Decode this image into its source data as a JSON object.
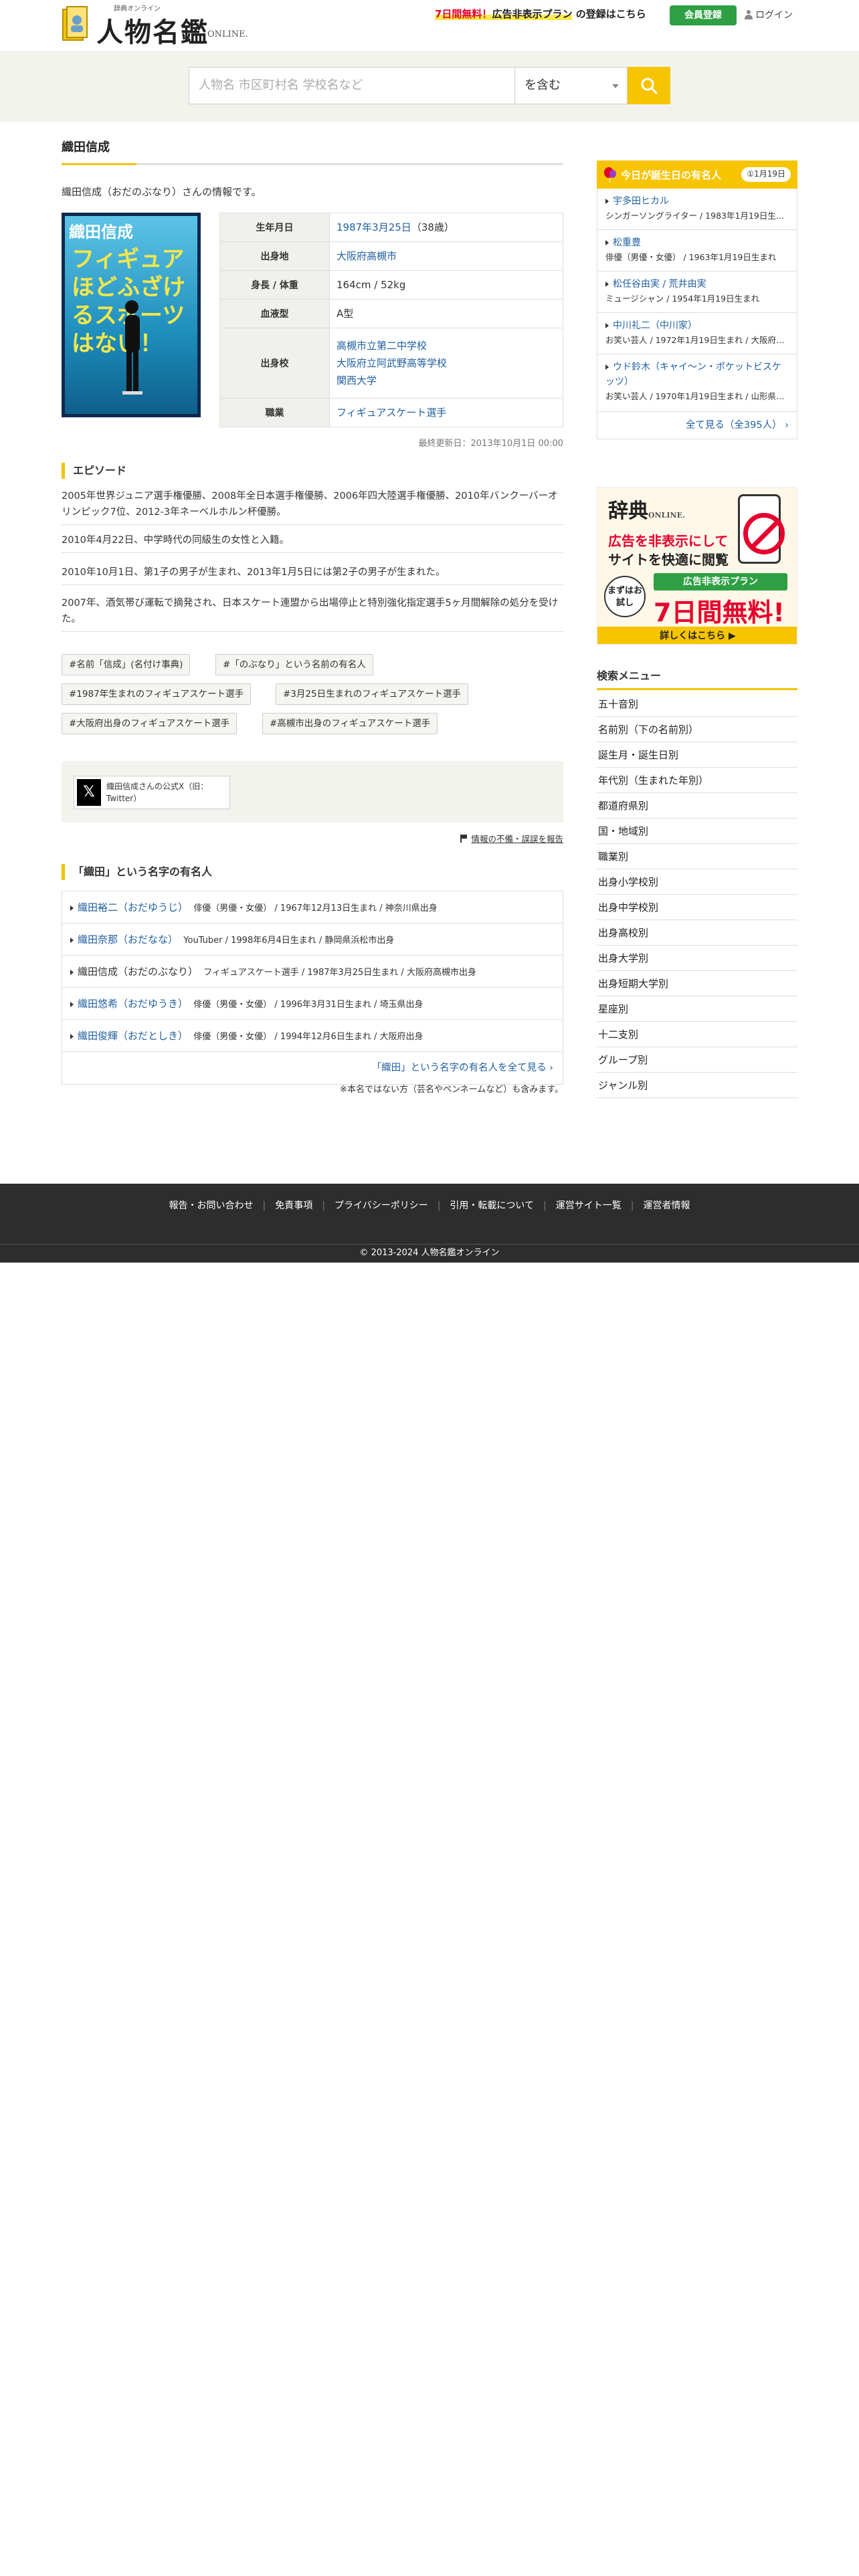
{
  "header": {
    "logo_small": "辞典オンライン",
    "logo_main": "人物名鑑",
    "logo_online": "ONLINE.",
    "promo_red": "7日間無料！",
    "promo_hl": "広告非表示プラン",
    "promo_rest": "の登録はこちら",
    "register_label": "会員登録",
    "login_label": "ログイン"
  },
  "search": {
    "placeholder": "人物名 市区町村名 学校名など",
    "mode": "を含む"
  },
  "main": {
    "title": "織田信成",
    "intro": "織田信成（おだのぶなり）さんの情報です。",
    "cover": {
      "name": "織田信成",
      "text": "フィギュアほどふざけるスポーツはない！"
    },
    "info": {
      "birth_label": "生年月日",
      "birth_value": "1987年3月25日",
      "birth_age": "（38歳）",
      "from_label": "出身地",
      "from_value": "大阪府高槻市",
      "body_label": "身長 / 体重",
      "body_value": "164cm / 52kg",
      "blood_label": "血液型",
      "blood_value": "A型",
      "school_label": "出身校",
      "schools": [
        "高槻市立第二中学校",
        "大阪府立阿武野高等学校",
        "関西大学"
      ],
      "job_label": "職業",
      "job_value": "フィギュアスケート選手"
    },
    "updated": "最終更新日：2013年10月1日 00:00",
    "episode_head": "エピソード",
    "episodes": [
      "2005年世界ジュニア選手権優勝、2008年全日本選手権優勝、2006年四大陸選手権優勝、2010年バンクーバーオリンピック7位、2012-3年ネーベルホルン杯優勝。",
      "2010年4月22日、中学時代の同級生の女性と入籍。",
      "2010年10月1日、第1子の男子が生まれ、2013年1月5日には第2子の男子が生まれた。",
      "2007年、酒気帯び運転で摘発され、日本スケート連盟から出場停止と特別強化指定選手5ヶ月間解除の処分を受けた。"
    ],
    "tags": [
      "#名前「信成」(名付け事典)",
      "#「のぶなり」という名前の有名人",
      "#1987年生まれのフィギュアスケート選手",
      "#3月25日生まれのフィギュアスケート選手",
      "#大阪府出身のフィギュアスケート選手",
      "#高槻市出身のフィギュアスケート選手"
    ],
    "twitter": {
      "x": "𝕏",
      "text": "織田信成さんの公式X（旧：Twitter）"
    },
    "report": "情報の不備・誤誤を報告",
    "surname_head": "「織田」という名字の有名人",
    "surname_people": [
      {
        "name": "織田裕二（おだゆうじ）",
        "desc": "俳優（男優・女優） / 1967年12月13日生まれ / 神奈川県出身",
        "link": true
      },
      {
        "name": "織田奈那（おだなな）",
        "desc": "YouTuber / 1998年6月4日生まれ / 静岡県浜松市出身",
        "link": true
      },
      {
        "name": "織田信成（おだのぶなり）",
        "desc": "フィギュアスケート選手 / 1987年3月25日生まれ / 大阪府高槻市出身",
        "link": false
      },
      {
        "name": "織田悠希（おだゆうき）",
        "desc": "俳優（男優・女優） / 1996年3月31日生まれ / 埼玉県出身",
        "link": true
      },
      {
        "name": "織田俊輝（おだとしき）",
        "desc": "俳優（男優・女優） / 1994年12月6日生まれ / 大阪府出身",
        "link": true
      }
    ],
    "surname_more": "「織田」という名字の有名人を全て見る",
    "note": "※本名ではない方（芸名やペンネームなど）も含みます。"
  },
  "sidebar": {
    "bday_title": "今日が誕生日の有名人",
    "bday_date": "①1月19日",
    "bday_people": [
      {
        "name": "宇多田ヒカル",
        "desc": "シンガーソングライター / 1983年1月19日生まれ"
      },
      {
        "name": "松重豊",
        "desc": "俳優（男優・女優） / 1963年1月19日生まれ"
      },
      {
        "name": "松任谷由実 / 荒井由実",
        "desc": "ミュージシャン / 1954年1月19日生まれ"
      },
      {
        "name": "中川礼二（中川家）",
        "desc": "お笑い芸人 / 1972年1月19日生まれ / 大阪府出身"
      },
      {
        "name": "ウド鈴木（キャイ～ン・ポケットビスケッツ）",
        "desc": "お笑い芸人 / 1970年1月19日生まれ / 山形県出身"
      }
    ],
    "bday_more": "全て見る（全395人）",
    "ad": {
      "logo": "辞典",
      "logo_online": "ONLINE.",
      "line1": "広告を非表示にして",
      "line2": "サイトを快適に閲覧",
      "try": "まずはお試し",
      "plan": "広告非表示プラン",
      "free": "7日間無料!",
      "cta": "詳しくはこちら ▶"
    },
    "menu_title": "検索メニュー",
    "menu": [
      "五十音別",
      "名前別（下の名前別）",
      "誕生月・誕生日別",
      "年代別（生まれた年別）",
      "都道府県別",
      "国・地域別",
      "職業別",
      "出身小学校別",
      "出身中学校別",
      "出身高校別",
      "出身大学別",
      "出身短期大学別",
      "星座別",
      "十二支別",
      "グループ別",
      "ジャンル別"
    ]
  },
  "footer": {
    "links": [
      "報告・お問い合わせ",
      "免責事項",
      "プライバシーポリシー",
      "引用・転載について",
      "運営サイト一覧",
      "運営者情報"
    ],
    "copyright": "© 2013-2024 人物名鑑オンライン"
  },
  "colors": {
    "accent": "#f2c200",
    "link": "#1f5f9f",
    "green": "#2ea043",
    "red": "#e5002d",
    "footer": "#2d2d2d"
  }
}
